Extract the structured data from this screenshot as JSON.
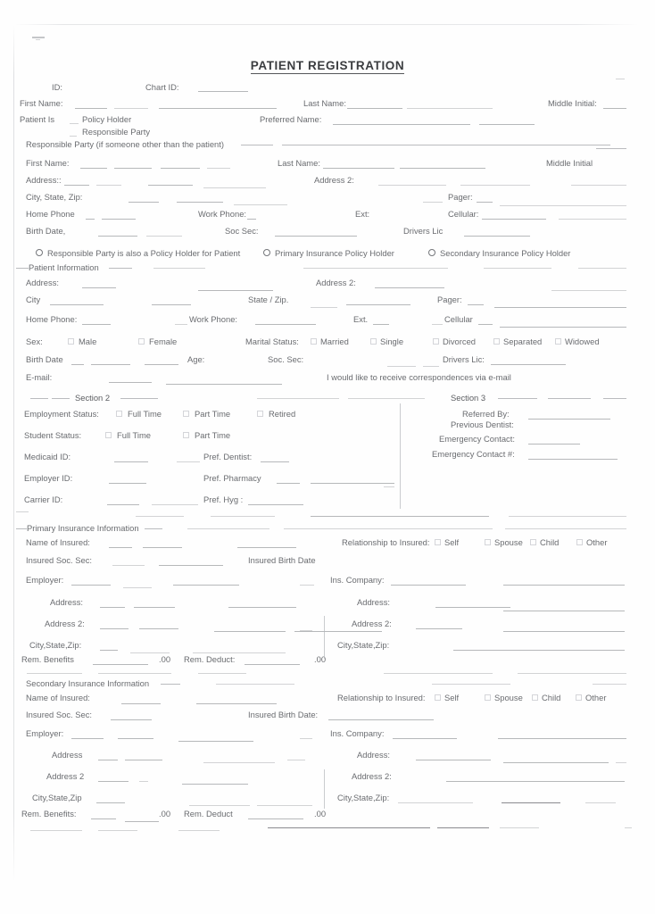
{
  "document": {
    "title": "PATIENT REGISTRATION"
  },
  "header_row": {
    "id_label": "ID:",
    "chart_id_label": "Chart ID:"
  },
  "name_row": {
    "first_name_label": "First Name:",
    "last_name_label": "Last Name:",
    "middle_initial_label": "Middle Initial:"
  },
  "patient_is": {
    "label": "Patient Is",
    "options": [
      "Policy Holder",
      "Responsible Party"
    ],
    "preferred_name_label": "Preferred Name:"
  },
  "responsible_party": {
    "group_label": "Responsible Party (if someone other than the patient)",
    "first_name_label": "First Name:",
    "last_name_label": "Last Name:",
    "middle_initial_label": "Middle Initial",
    "address_label": "Address::",
    "address2_label": "Address 2:",
    "city_state_zip_label": "City, State, Zip:",
    "pager_label": "Pager:",
    "home_phone_label": "Home Phone",
    "work_phone_label": "Work Phone:",
    "ext_label": "Ext:",
    "cellular_label": "Cellular:",
    "birth_date_label": "Birth Date,",
    "soc_sec_label": "Soc Sec:",
    "drivers_lic_label": "Drivers Lic"
  },
  "policy_holder_radios": [
    "Responsible Party is also a Policy Holder for Patient",
    "Primary Insurance Policy Holder",
    "Secondary Insurance Policy Holder"
  ],
  "patient_information": {
    "group_label": "Patient Information",
    "address_label": "Address:",
    "address2_label": "Address 2:",
    "city_label": "City",
    "state_zip_label": "State / Zip.",
    "pager_label": "Pager:",
    "home_phone_label": "Home Phone:",
    "work_phone_label": "Work Phone:",
    "ext_label": "Ext.",
    "cellular_label": "Cellular",
    "sex_label": "Sex:",
    "sex_options": [
      "Male",
      "Female"
    ],
    "marital_status_label": "Marital Status:",
    "marital_options": [
      "Married",
      "Single",
      "Divorced",
      "Separated",
      "Widowed"
    ],
    "birth_date_label": "Birth Date",
    "age_label": "Age:",
    "soc_sec_label": "Soc. Sec:",
    "drivers_lic_label": "Drivers Lic:",
    "email_label": "E-mail:",
    "email_optin_label": "I would like to receive correspondences via e-mail"
  },
  "section2": {
    "title": "Section 2",
    "employment_status_label": "Employment Status:",
    "employment_options": [
      "Full Time",
      "Part Time",
      "Retired"
    ],
    "student_status_label": "Student Status:",
    "student_options": [
      "Full Time",
      "Part Time"
    ],
    "medicaid_id_label": "Medicaid ID:",
    "pref_dentist_label": "Pref. Dentist:",
    "employer_id_label": "Employer ID:",
    "pref_pharmacy_label": "Pref. Pharmacy",
    "carrier_id_label": "Carrier ID:",
    "pref_hyg_label": "Pref. Hyg :"
  },
  "section3": {
    "title": "Section 3",
    "referred_by_label": "Referred By:",
    "previous_dentist_label": "Previous Dentist:",
    "emergency_contact_label": "Emergency Contact:",
    "emergency_contact_number_label": "Emergency Contact #:"
  },
  "primary_insurance": {
    "group_label": "Primary Insurance Information",
    "name_of_insured_label": "Name of Insured:",
    "relationship_label": "Relationship to Insured:",
    "relationship_options": [
      "Self",
      "Spouse",
      "Child",
      "Other"
    ],
    "insured_soc_sec_label": "Insured Soc. Sec:",
    "insured_birth_date_label": "Insured Birth Date",
    "employer_label": "Employer:",
    "ins_company_label": "Ins. Company:",
    "address_label": "Address:",
    "address2_label": "Address 2:",
    "city_state_zip_label": "City,State,Zip:",
    "ins_address_label": "Address:",
    "ins_address2_label": "Address 2:",
    "ins_city_state_zip_label": "City,State,Zip:",
    "rem_benefits_label": "Rem. Benefits",
    "rem_benefits_cents": ".00",
    "rem_deduct_label": "Rem. Deduct:",
    "rem_deduct_cents": ".00"
  },
  "secondary_insurance": {
    "group_label": "Secondary Insurance Information",
    "name_of_insured_label": "Name of Insured:",
    "relationship_label": "Relationship to Insured:",
    "relationship_options": [
      "Self",
      "Spouse",
      "Child",
      "Other"
    ],
    "insured_soc_sec_label": "Insured Soc. Sec:",
    "insured_birth_date_label": "Insured Birth Date:",
    "employer_label": "Employer:",
    "ins_company_label": "Ins. Company:",
    "address_label": "Address",
    "address2_label": "Address 2",
    "city_state_zip_label": "City,State,Zip",
    "ins_address_label": "Address:",
    "ins_address2_label": "Address 2:",
    "ins_city_state_zip_label": "City,State,Zip:",
    "rem_benefits_label": "Rem. Benefits:",
    "rem_benefits_cents": ".00",
    "rem_deduct_label": "Rem. Deduct",
    "rem_deduct_cents": ".00"
  }
}
